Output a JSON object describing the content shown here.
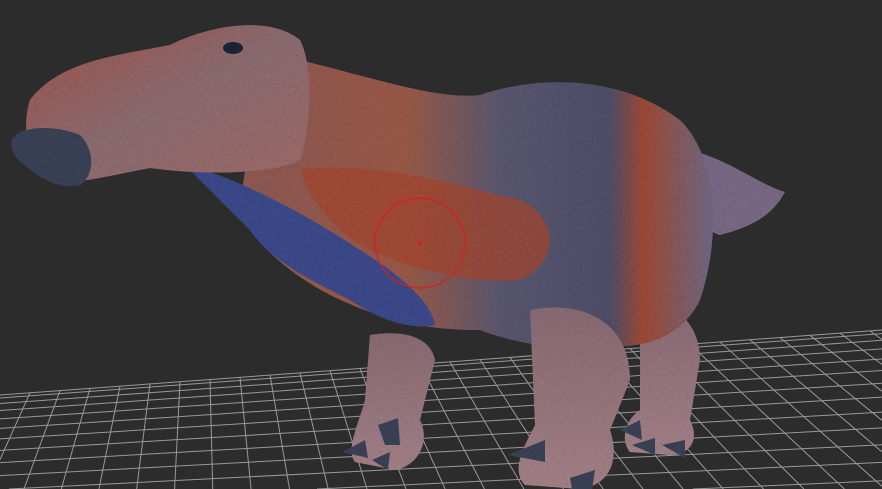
{
  "viewport": {
    "background_color": "#2c2c2c",
    "grid_color": "#bdbdbd",
    "model": "dinosaur-sculpt",
    "brush_cursor_color": "#d42020",
    "colors": {
      "skin_base": "#8a6f78",
      "skin_red": "#b8452a",
      "skin_blue": "#3a4a8a",
      "skin_dark": "#4d4f6a",
      "claw": "#3b4257"
    }
  }
}
